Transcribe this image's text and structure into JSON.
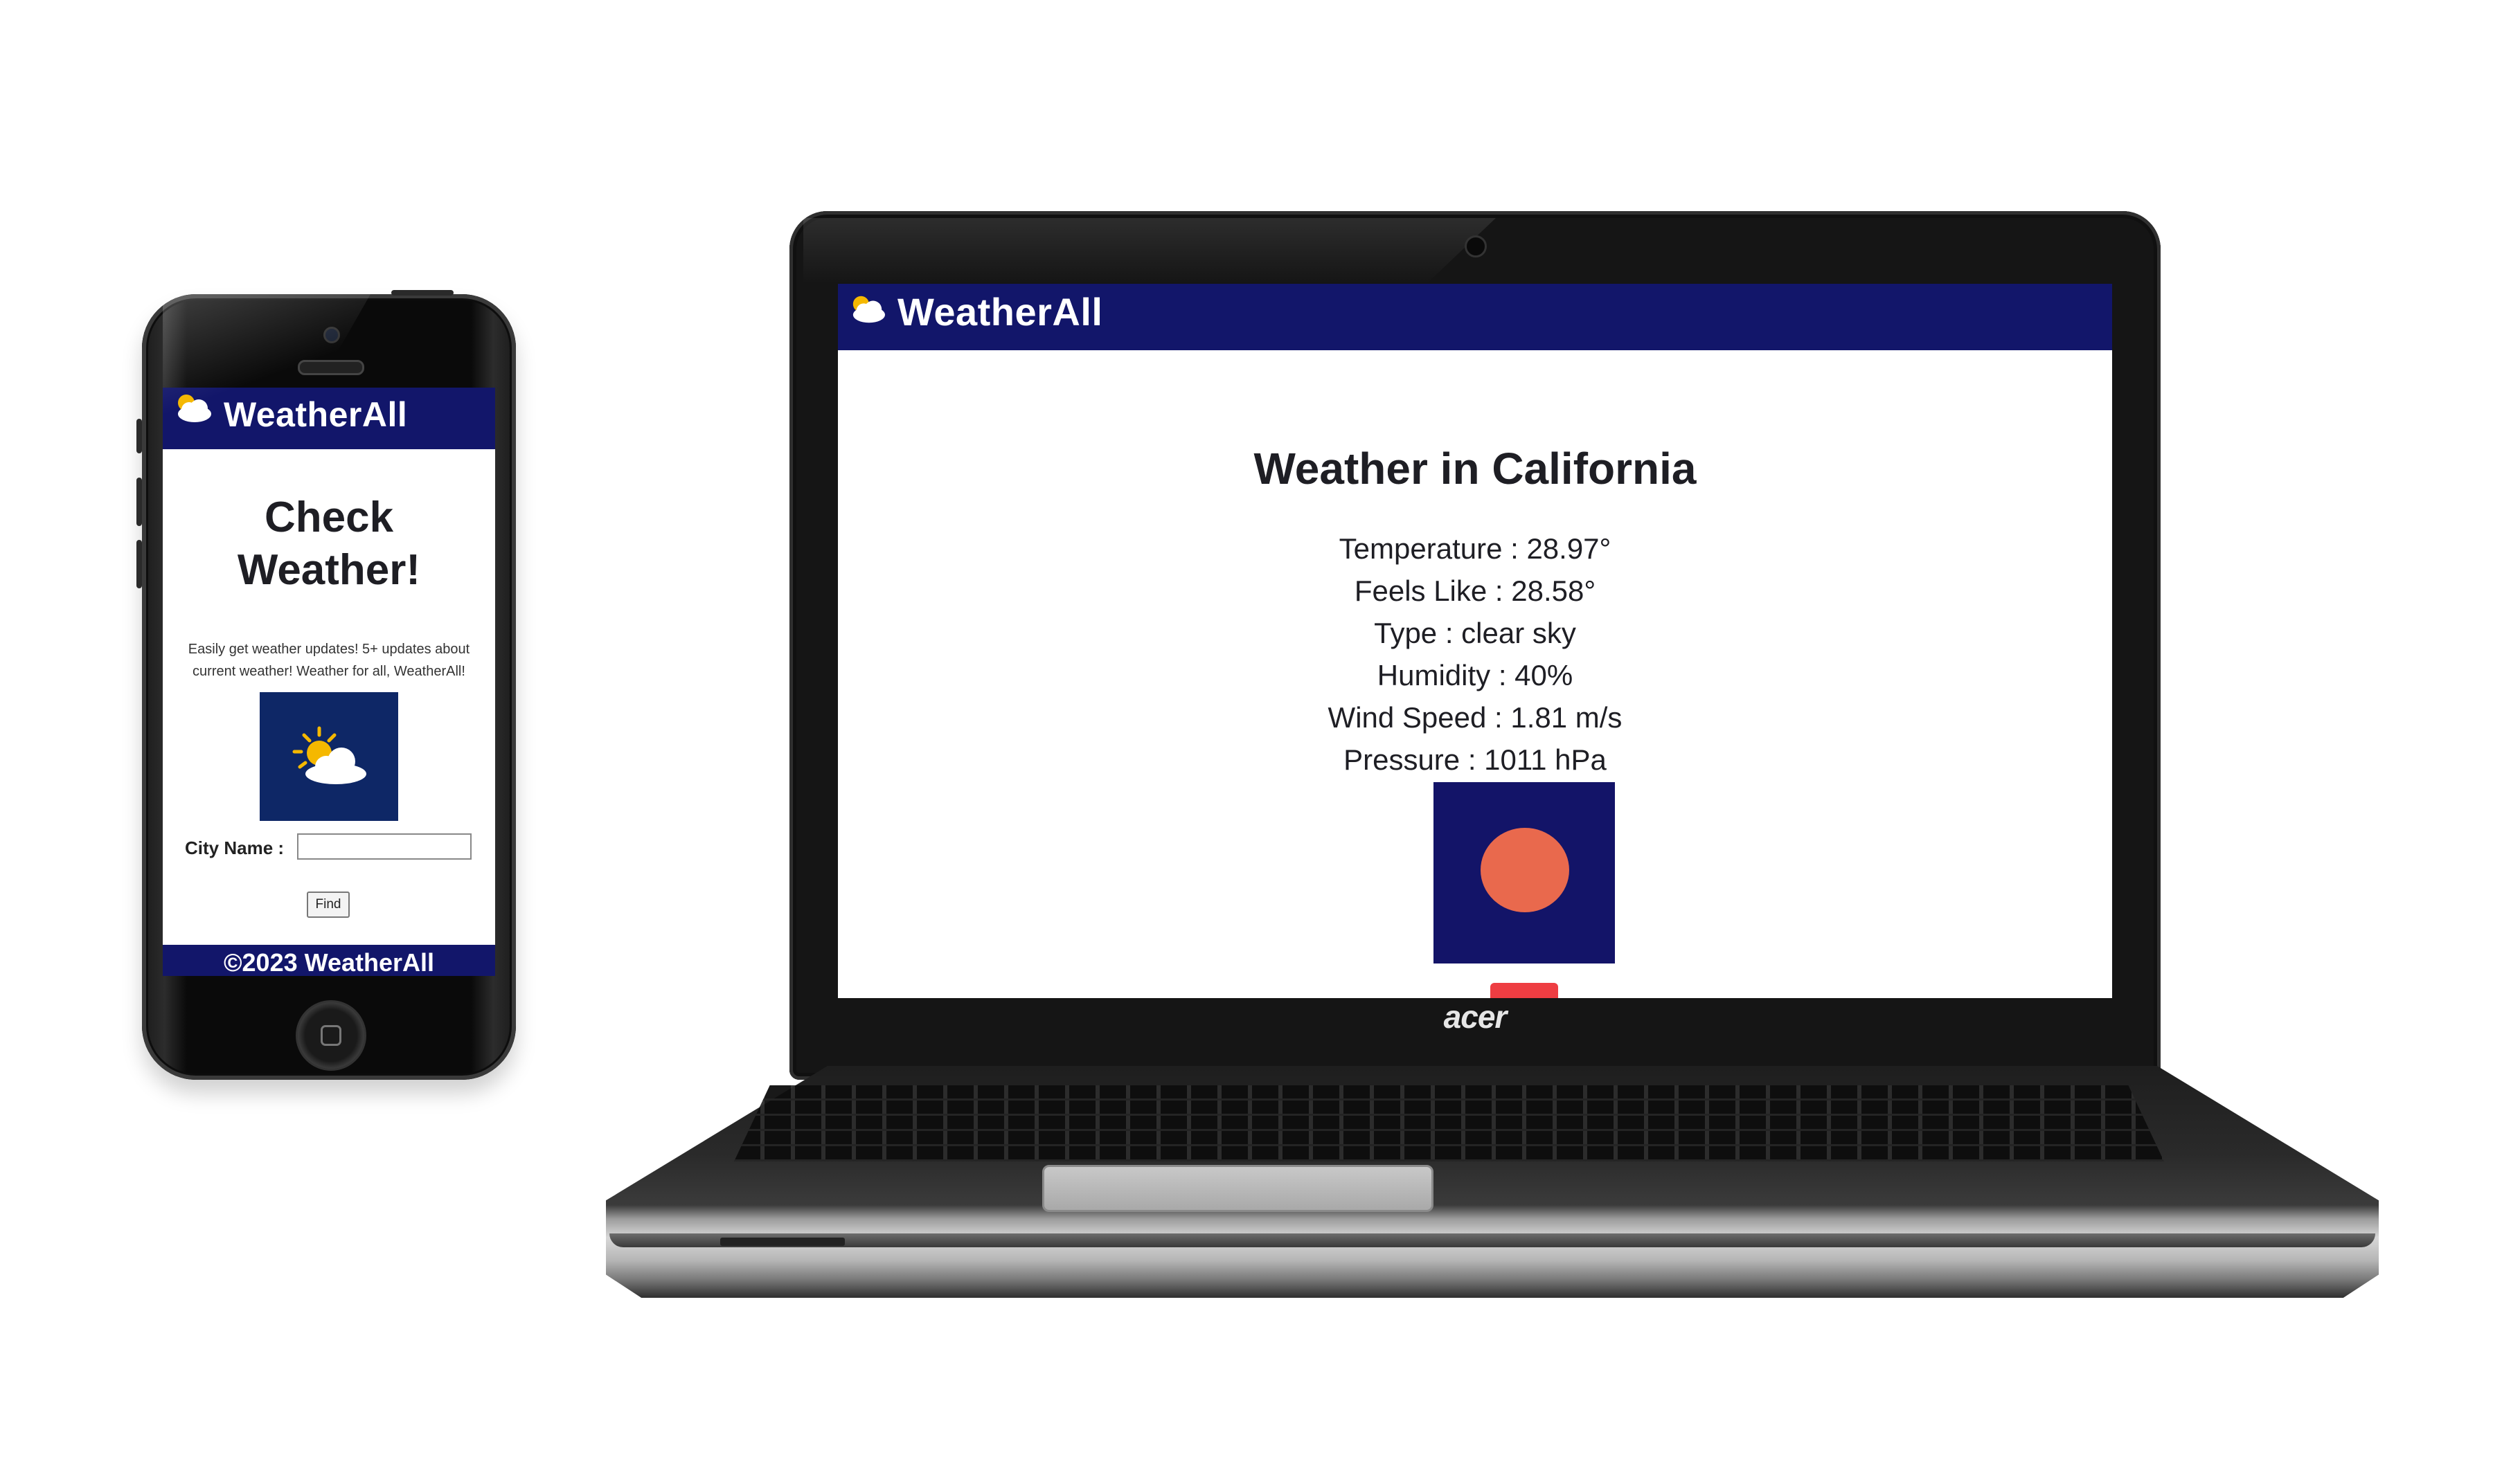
{
  "phone": {
    "app": {
      "brand": "WeatherAll",
      "title_line1": "Check",
      "title_line2": "Weather!",
      "description_line1": "Easily get weather updates! 5+ updates about",
      "description_line2": "current weather! Weather for all, WeatherAll!",
      "city_label": "City Name :",
      "city_input_value": "",
      "find_button": "Find",
      "footer": "©2023 WeatherAll"
    }
  },
  "laptop": {
    "brand_logo_text": "acer",
    "app": {
      "brand": "WeatherAll",
      "title": "Weather in California",
      "stats": [
        "Temperature : 28.97°",
        "Feels Like : 28.58°",
        "Type : clear sky",
        "Humidity : 40%",
        "Wind Speed : 1.81 m/s",
        "Pressure : 1011 hPa"
      ],
      "weather_icon": "clear-sky-sun-icon"
    }
  },
  "colors": {
    "header_navy": "#12166a",
    "image_bg_phone": "#0e2766",
    "image_bg_laptop": "#131468",
    "sun_orange": "#e9694d",
    "button_red": "#ee3d42"
  }
}
